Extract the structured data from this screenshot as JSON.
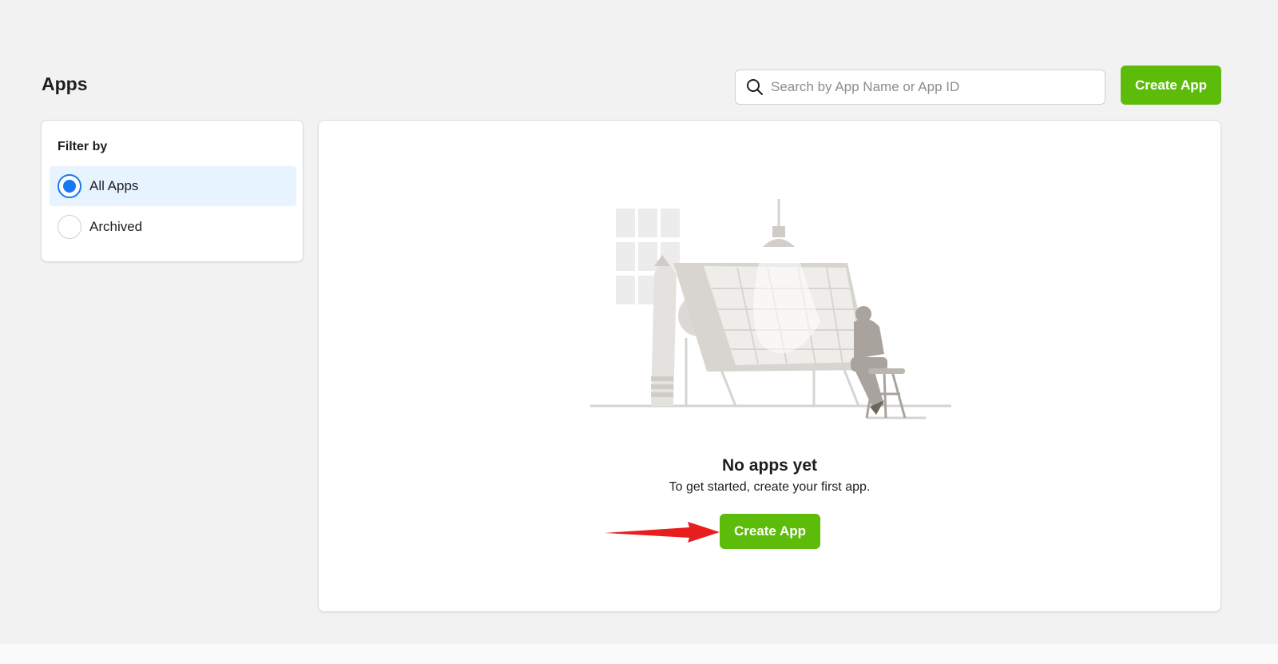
{
  "page": {
    "title": "Apps"
  },
  "search": {
    "placeholder": "Search by App Name or App ID",
    "value": ""
  },
  "header": {
    "create_label": "Create App"
  },
  "filter": {
    "title": "Filter by",
    "options": [
      {
        "label": "All Apps",
        "selected": true
      },
      {
        "label": "Archived",
        "selected": false
      }
    ]
  },
  "empty_state": {
    "title": "No apps yet",
    "subtitle": "To get started, create your first app.",
    "create_label": "Create App"
  },
  "colors": {
    "accent_green": "#5dbb0a",
    "radio_blue": "#1877f2",
    "selected_bg": "#e7f3ff",
    "arrow_red": "#e81e1e"
  },
  "icons": [
    "search-icon",
    "empty-state-illustration",
    "red-arrow-annotation"
  ]
}
